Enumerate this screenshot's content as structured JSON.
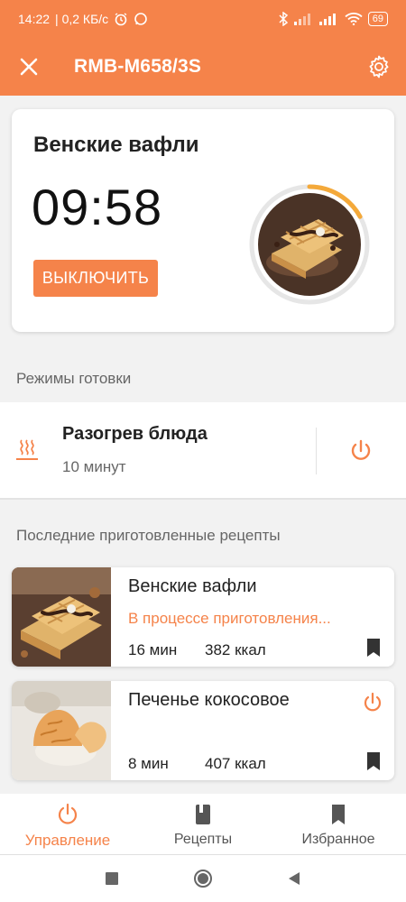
{
  "status_bar": {
    "time": "14:22",
    "speed": "| 0,2 КБ/с",
    "battery": "69"
  },
  "app_bar": {
    "title": "RMB-M658/3S"
  },
  "cooking": {
    "dish": "Венские вафли",
    "timer": "09:58",
    "off_button": "ВЫКЛЮЧИТЬ",
    "progress_fraction": 0.17
  },
  "modes_section": {
    "title": "Режимы готовки",
    "item": {
      "name": "Разогрев блюда",
      "duration": "10 минут"
    }
  },
  "recent_section": {
    "title": "Последние приготовленные рецепты",
    "recipes": [
      {
        "name": "Венские вафли",
        "status": "В процессе приготовления...",
        "time": "16 мин",
        "kcal": "382 ккал"
      },
      {
        "name": "Печенье кокосовое",
        "time": "8 мин",
        "kcal": "407 ккал"
      }
    ]
  },
  "bottom_nav": {
    "items": [
      {
        "label": "Управление",
        "icon": "power-icon",
        "active": true
      },
      {
        "label": "Рецепты",
        "icon": "book-icon",
        "active": false
      },
      {
        "label": "Избранное",
        "icon": "bookmark-icon",
        "active": false
      }
    ]
  },
  "colors": {
    "accent": "#f5834a",
    "background": "#f2f2f2",
    "card": "#ffffff"
  }
}
